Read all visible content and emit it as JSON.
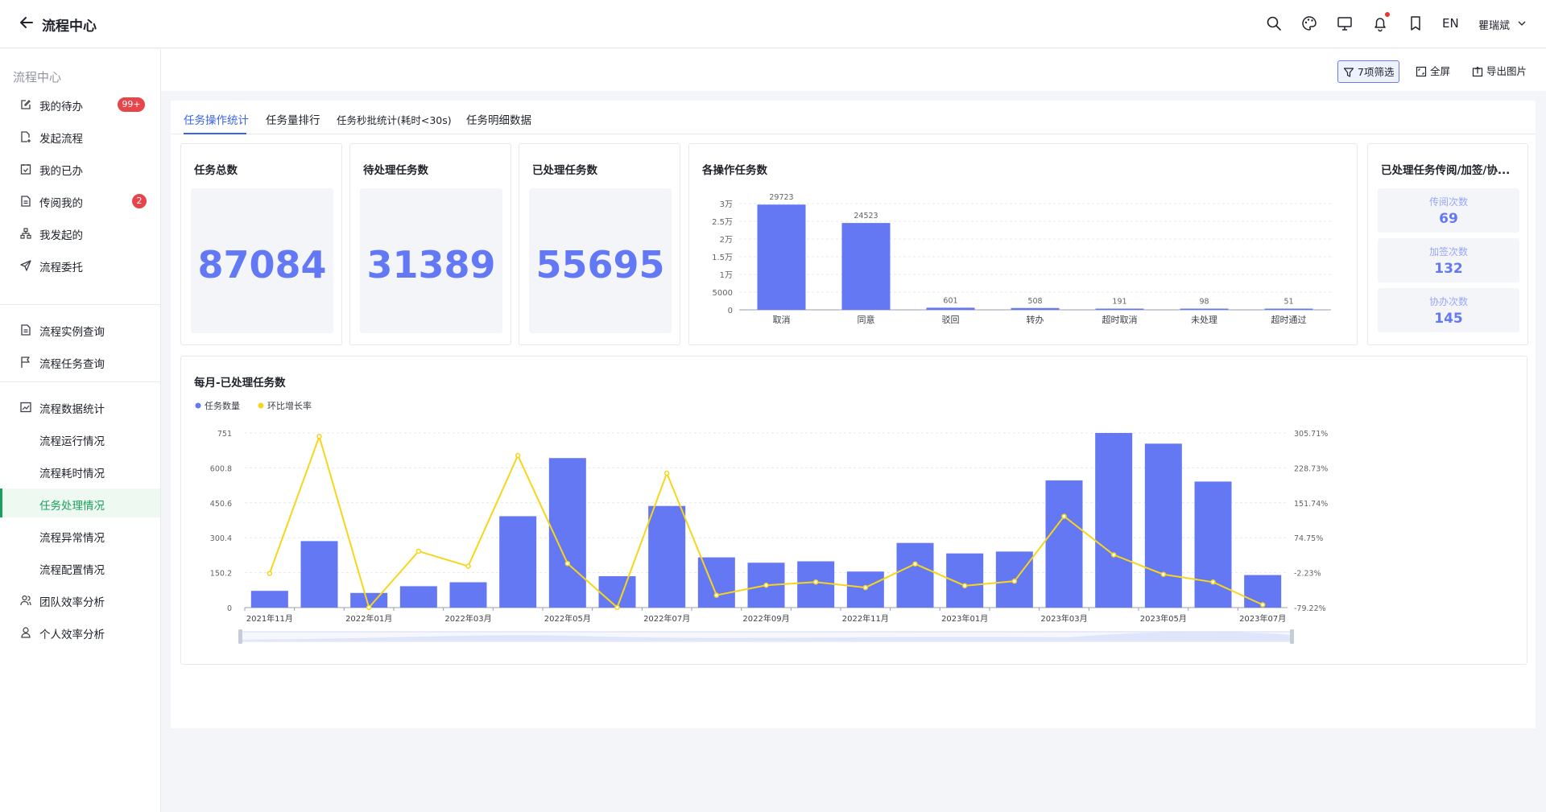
{
  "topbar": {
    "title": "流程中心",
    "lang": "EN",
    "user": "瞿瑞斌"
  },
  "sidebar": {
    "title": "流程中心",
    "items": [
      {
        "label": "我的待办",
        "badge": "99+"
      },
      {
        "label": "发起流程"
      },
      {
        "label": "我的已办"
      },
      {
        "label": "传阅我的",
        "badge": "2"
      },
      {
        "label": "我发起的"
      },
      {
        "label": "流程委托"
      },
      {
        "label": "流程实例查询"
      },
      {
        "label": "流程任务查询"
      },
      {
        "label": "流程数据统计"
      },
      {
        "label": "流程运行情况"
      },
      {
        "label": "流程耗时情况"
      },
      {
        "label": "任务处理情况"
      },
      {
        "label": "流程异常情况"
      },
      {
        "label": "流程配置情况"
      },
      {
        "label": "团队效率分析"
      },
      {
        "label": "个人效率分析"
      }
    ]
  },
  "actions": {
    "filter": "7项筛选",
    "fullscreen": "全屏",
    "export": "导出图片"
  },
  "tabs": [
    "任务操作统计",
    "任务量排行",
    "任务秒批统计(耗时<30s)",
    "任务明细数据"
  ],
  "kpis": [
    {
      "title": "任务总数",
      "value": "87084"
    },
    {
      "title": "待处理任务数",
      "value": "31389"
    },
    {
      "title": "已处理任务数",
      "value": "55695"
    }
  ],
  "side_card": {
    "title": "已处理任务传阅/加签/协...",
    "items": [
      {
        "label": "传阅次数",
        "value": "69"
      },
      {
        "label": "加签次数",
        "value": "132"
      },
      {
        "label": "协办次数",
        "value": "145"
      }
    ]
  },
  "colors": {
    "accent": "#6278f5",
    "bar": "#6478f4",
    "line": "#f7d51a",
    "active_green": "#1aa05b",
    "badge_red": "#e5454b"
  },
  "chart_data": [
    {
      "type": "bar",
      "title": "各操作任务数",
      "categories": [
        "取消",
        "同意",
        "驳回",
        "转办",
        "超时取消",
        "未处理",
        "超时通过"
      ],
      "values": [
        29723,
        24523,
        601,
        508,
        191,
        98,
        51
      ],
      "data_labels": [
        "29723",
        "24523",
        "601",
        "508",
        "191",
        "98",
        "51"
      ],
      "yticks": [
        "0",
        "5000",
        "1万",
        "1.5万",
        "2万",
        "2.5万",
        "3万"
      ],
      "ylim": [
        0,
        30000
      ],
      "grid": true
    },
    {
      "type": "bar+line",
      "title": "每月-已处理任务数",
      "legend": [
        "任务数量",
        "环比增长率"
      ],
      "legend_position": "top-left",
      "x": [
        "2021年11月",
        "2021年12月",
        "2022年01月",
        "2022年02月",
        "2022年03月",
        "2022年04月",
        "2022年05月",
        "2022年06月",
        "2022年07月",
        "2022年08月",
        "2022年09月",
        "2022年10月",
        "2022年11月",
        "2022年12月",
        "2023年01月",
        "2023年02月",
        "2023年03月",
        "2023年04月",
        "2023年05月",
        "2023年06月",
        "2023年07月"
      ],
      "xtick_labels": [
        "2021年11月",
        "2022年01月",
        "2022年03月",
        "2022年05月",
        "2022年07月",
        "2022年09月",
        "2022年11月",
        "2023年01月",
        "2023年03月",
        "2023年05月",
        "2023年07月"
      ],
      "series": [
        {
          "name": "任务数量",
          "axis": "left",
          "values": [
            72,
            286,
            63,
            92,
            109,
            393,
            643,
            135,
            437,
            216,
            193,
            199,
            155,
            278,
            233,
            241,
            547,
            751,
            705,
            542,
            140
          ]
        },
        {
          "name": "环比增长率",
          "axis": "right",
          "values": [
            -4,
            298,
            -79,
            45,
            12,
            256,
            18,
            -79,
            217,
            -52,
            -30,
            -23,
            -35,
            17,
            -31,
            -21,
            122,
            37,
            -6,
            -23,
            -73
          ]
        }
      ],
      "y_left_ticks": [
        "0",
        "150.2",
        "300.4",
        "450.6",
        "600.8",
        "751"
      ],
      "y_left_lim": [
        0,
        751
      ],
      "y_right_ticks": [
        "-79.22%",
        "-2.23%",
        "74.75%",
        "151.74%",
        "228.73%",
        "305.71%"
      ],
      "y_right_lim": [
        -79.22,
        305.71
      ],
      "grid": true
    }
  ]
}
